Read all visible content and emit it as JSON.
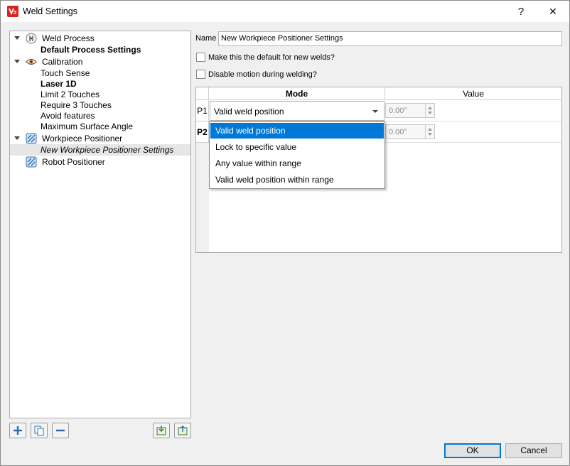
{
  "window": {
    "title": "Weld Settings",
    "help_label": "?",
    "close_label": "✕"
  },
  "tree": {
    "items": [
      {
        "label": "Weld Process",
        "icon": "weld-process-icon",
        "expanded": true
      },
      {
        "label": "Default Process Settings",
        "bold": true
      },
      {
        "label": "Calibration",
        "icon": "eye-icon",
        "expanded": true
      },
      {
        "label": "Touch Sense"
      },
      {
        "label": "Laser 1D",
        "bold": true
      },
      {
        "label": "Limit 2 Touches"
      },
      {
        "label": "Require 3 Touches"
      },
      {
        "label": "Avoid features"
      },
      {
        "label": "Maximum Surface Angle"
      },
      {
        "label": "Workpiece Positioner",
        "icon": "positioner-icon",
        "expanded": true
      },
      {
        "label": "New Workpiece Positioner Settings",
        "italic": true,
        "selected": true
      },
      {
        "label": "Robot Positioner",
        "icon": "positioner-icon"
      }
    ]
  },
  "form": {
    "name_label": "Name",
    "name_value": "New Workpiece Positioner Settings",
    "default_checkbox_label": "Make this the default for new welds?",
    "disable_motion_label": "Disable motion during welding?"
  },
  "grid": {
    "headers": {
      "mode": "Mode",
      "value": "Value"
    },
    "rows": [
      {
        "label": "P1",
        "mode": "Valid weld position",
        "value": "0.00°"
      },
      {
        "label": "P2",
        "mode": "",
        "value": "0.00°"
      }
    ]
  },
  "dropdown": {
    "options": [
      "Valid weld position",
      "Lock to specific value",
      "Any value within range",
      "Valid weld position within range"
    ],
    "highlighted": 0
  },
  "buttons": {
    "ok": "OK",
    "cancel": "Cancel"
  },
  "colors": {
    "accent": "#0078d7",
    "app_icon": "#d9241c"
  }
}
